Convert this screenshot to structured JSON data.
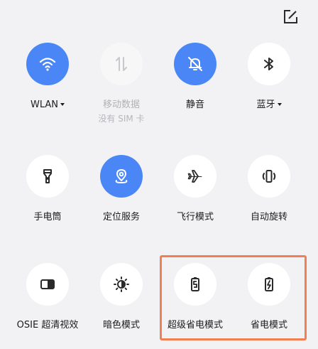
{
  "header": {
    "edit_icon": "edit-square-icon"
  },
  "tiles": [
    {
      "label": "WLAN",
      "sublabel": "",
      "icon": "wifi-icon",
      "state": "active",
      "dropdown": true
    },
    {
      "label": "移动数据",
      "sublabel": "没有 SIM 卡",
      "icon": "data-arrows-icon",
      "state": "disabled",
      "dropdown": false
    },
    {
      "label": "静音",
      "sublabel": "",
      "icon": "bell-off-icon",
      "state": "active",
      "dropdown": false
    },
    {
      "label": "蓝牙",
      "sublabel": "",
      "icon": "bluetooth-icon",
      "state": "inactive",
      "dropdown": true
    },
    {
      "label": "手电筒",
      "sublabel": "",
      "icon": "flashlight-icon",
      "state": "inactive",
      "dropdown": false
    },
    {
      "label": "定位服务",
      "sublabel": "",
      "icon": "location-icon",
      "state": "active",
      "dropdown": false
    },
    {
      "label": "飞行模式",
      "sublabel": "",
      "icon": "airplane-icon",
      "state": "inactive",
      "dropdown": false
    },
    {
      "label": "自动旋转",
      "sublabel": "",
      "icon": "rotate-icon",
      "state": "inactive",
      "dropdown": false
    },
    {
      "label": "OSIE 超清视效",
      "sublabel": "",
      "icon": "display-enhance-icon",
      "state": "inactive",
      "dropdown": false
    },
    {
      "label": "暗色模式",
      "sublabel": "",
      "icon": "dark-mode-icon",
      "state": "inactive",
      "dropdown": false
    },
    {
      "label": "超级省电模式",
      "sublabel": "",
      "icon": "super-power-saving-icon",
      "state": "inactive",
      "dropdown": false
    },
    {
      "label": "省电模式",
      "sublabel": "",
      "icon": "power-saving-icon",
      "state": "inactive",
      "dropdown": false
    }
  ],
  "colors": {
    "active": "#4a86f5",
    "highlight": "#f07f53",
    "background": "#f2f2f4"
  }
}
